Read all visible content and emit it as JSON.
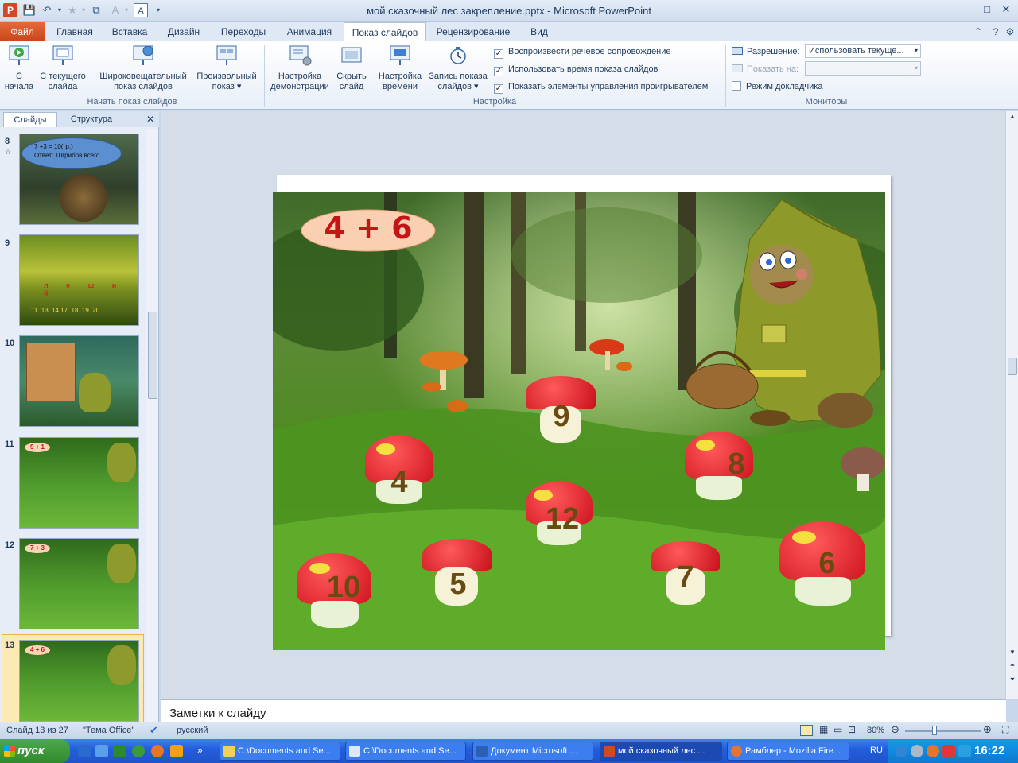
{
  "window": {
    "title": "мой сказочный лес  закрепление.pptx  -  Microsoft PowerPoint",
    "minimize": "–",
    "maximize": "□",
    "close": "✕"
  },
  "tabs": [
    "Файл",
    "Главная",
    "Вставка",
    "Дизайн",
    "Переходы",
    "Анимация",
    "Показ слайдов",
    "Рецензирование",
    "Вид"
  ],
  "ribbon": {
    "groups": {
      "start": "Начать показ слайдов",
      "setup": "Настройка",
      "monitors": "Мониторы"
    },
    "buttons": {
      "from_start": "С\nначала",
      "from_current": "С текущего\nслайда",
      "broadcast": "Широковещательный\nпоказ слайдов",
      "custom": "Произвольный\nпоказ ▾",
      "setup_show": "Настройка\nдемонстрации",
      "hide_slide": "Скрыть\nслайд",
      "rehearse": "Настройка\nвремени",
      "record": "Запись показа\nслайдов ▾"
    },
    "checkboxes": {
      "narration": "Воспроизвести речевое сопровождение",
      "timings": "Использовать время показа слайдов",
      "media_controls": "Показать элементы управления проигрывателем",
      "presenter_view": "Режим докладчика"
    },
    "monitors": {
      "resolution_label": "Разрешение:",
      "resolution_value": "Использовать текуще...",
      "show_on_label": "Показать на:"
    }
  },
  "panel": {
    "tab_slides": "Слайды",
    "tab_outline": "Структура",
    "close": "✕",
    "thumbs": [
      {
        "num": "8",
        "text1": "7 +3 = 10(гр.)",
        "text2": "Ответ:  10грибов  всего"
      },
      {
        "num": "9",
        "letters": "л е ш и й",
        "numbers": "11  13  14 17  18  19  20"
      },
      {
        "num": "10"
      },
      {
        "num": "11",
        "badge": "9 + 1"
      },
      {
        "num": "12",
        "badge": "7 + 3"
      },
      {
        "num": "13",
        "badge": "4 + 6"
      }
    ]
  },
  "slide": {
    "expression": "4 + 6",
    "mushrooms": [
      "9",
      "4",
      "8",
      "12",
      "10",
      "5",
      "7",
      "6"
    ]
  },
  "notes_placeholder": "Заметки к слайду",
  "status": {
    "slide_pos": "Слайд 13 из 27",
    "theme": "\"Тема Office\"",
    "language": "русский",
    "zoom": "80%"
  },
  "taskbar": {
    "start": "пуск",
    "apps": [
      "C:\\Documents and Se...",
      "C:\\Documents and Se...",
      "Документ Microsoft ...",
      "мой сказочный лес ...",
      "Рамблер - Mozilla Fire..."
    ],
    "lang": "RU",
    "time": "16:22"
  },
  "colors": {
    "accent_orange": "#d24726",
    "ribbon_blue": "#1e395b",
    "mushroom_red": "#e8262e",
    "number_brown": "#6b4a12",
    "badge_red": "#c41414"
  }
}
